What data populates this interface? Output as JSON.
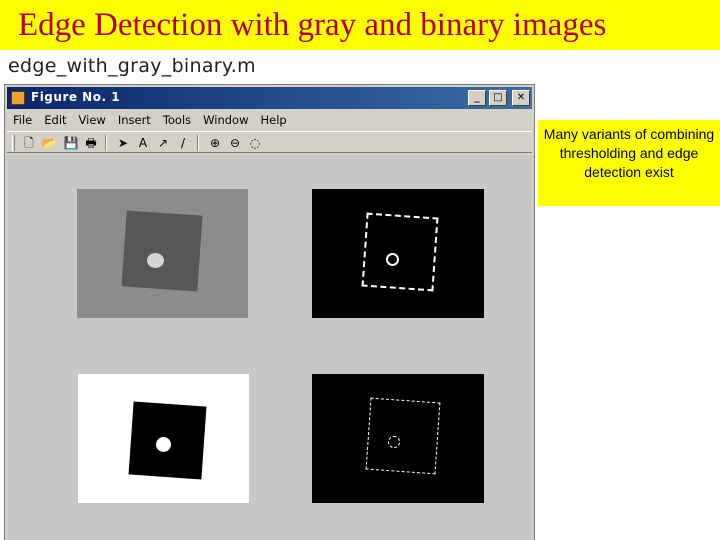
{
  "slide": {
    "title": "Edge Detection with gray and binary images",
    "filename": "edge_with_gray_binary.m",
    "note": "Many variants of combining thresholding and edge detection exist"
  },
  "window": {
    "title": "Figure No. 1",
    "buttons": {
      "minimize": "_",
      "maximize": "□",
      "close": "✕"
    },
    "menu": [
      "File",
      "Edit",
      "View",
      "Insert",
      "Tools",
      "Window",
      "Help"
    ]
  },
  "toolbar": {
    "icons": [
      "new-file-icon",
      "open-folder-icon",
      "save-icon",
      "print-icon",
      "select-arrow-icon",
      "insert-text-icon",
      "insert-arrow-icon",
      "insert-line-icon",
      "zoom-in-icon",
      "zoom-out-icon",
      "rotate-icon"
    ],
    "glyphs": {
      "new": "🗋",
      "open": "📂",
      "save": "💾",
      "print": "🖶",
      "select": "➤",
      "text": "A",
      "arrow": "↗",
      "line": "/",
      "zoom_in": "⊕",
      "zoom_out": "⊖",
      "rotate": "◌"
    }
  },
  "images": [
    {
      "name": "gray-image",
      "kind": "grayscale"
    },
    {
      "name": "edge-image-1",
      "kind": "edges"
    },
    {
      "name": "binary-image",
      "kind": "binary"
    },
    {
      "name": "edge-image-2",
      "kind": "edges"
    }
  ],
  "colors": {
    "title_bg": "#ffff00",
    "title_text": "#b0002a",
    "window_bg": "#d4d0c8",
    "titlebar_start": "#0a246a",
    "titlebar_end": "#3a6ea5"
  }
}
